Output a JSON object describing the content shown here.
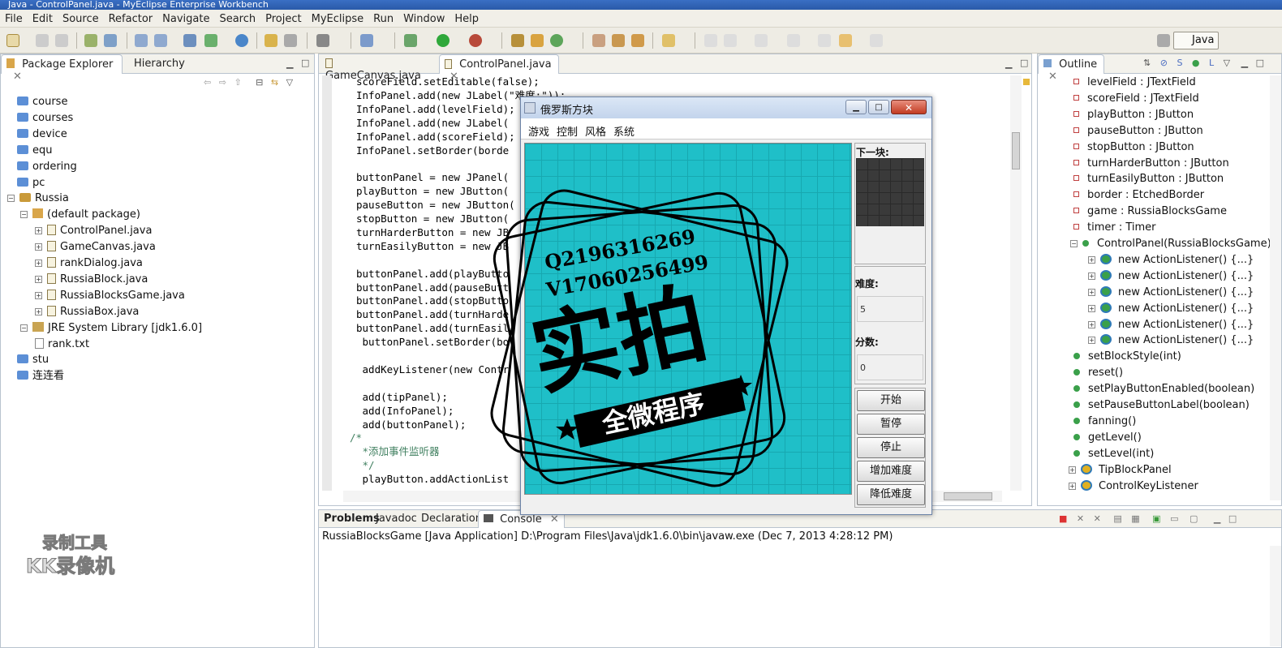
{
  "window": {
    "title": "Java - ControlPanel.java - MyEclipse Enterprise Workbench"
  },
  "menu": [
    "File",
    "Edit",
    "Source",
    "Refactor",
    "Navigate",
    "Search",
    "Project",
    "MyEclipse",
    "Run",
    "Window",
    "Help"
  ],
  "perspective": {
    "label": "Java"
  },
  "package_explorer": {
    "tab_label": "Package Explorer",
    "hierarchy_label": "Hierarchy",
    "items": [
      {
        "label": "course",
        "icon": "folder-icon"
      },
      {
        "label": "courses",
        "icon": "folder-icon"
      },
      {
        "label": "device",
        "icon": "folder-icon"
      },
      {
        "label": "equ",
        "icon": "folder-icon"
      },
      {
        "label": "ordering",
        "icon": "folder-icon"
      },
      {
        "label": "pc",
        "icon": "folder-icon"
      },
      {
        "label": "Russia",
        "icon": "project-icon"
      },
      {
        "label": "(default package)",
        "icon": "package-icon"
      },
      {
        "label": "ControlPanel.java",
        "icon": "java-file-icon"
      },
      {
        "label": "GameCanvas.java",
        "icon": "java-file-icon"
      },
      {
        "label": "rankDialog.java",
        "icon": "java-file-icon"
      },
      {
        "label": "RussiaBlock.java",
        "icon": "java-file-icon"
      },
      {
        "label": "RussiaBlocksGame.java",
        "icon": "java-file-icon"
      },
      {
        "label": "RussiaBox.java",
        "icon": "java-file-icon"
      },
      {
        "label": "JRE System Library [jdk1.6.0]",
        "icon": "library-icon"
      },
      {
        "label": "rank.txt",
        "icon": "text-file-icon"
      },
      {
        "label": "stu",
        "icon": "folder-icon"
      },
      {
        "label": "连连看",
        "icon": "folder-icon"
      }
    ]
  },
  "editor": {
    "tabs": [
      {
        "label": "GameCanvas.java"
      },
      {
        "label": "ControlPanel.java"
      }
    ],
    "lines": [
      "scoreField.setEditable(false);",
      "InfoPanel.add(new JLabel(\"难度:\"));",
      "InfoPanel.add(levelField);",
      "InfoPanel.add(new JLabel(",
      "InfoPanel.add(scoreField);",
      "InfoPanel.setBorder(borde",
      "",
      "buttonPanel = new JPanel(",
      "playButton = new JButton(",
      "pauseButton = new JButton(",
      "stopButton = new JButton(",
      "turnHarderButton = new JB",
      "turnEasilyButton = new JB",
      "",
      "buttonPanel.add(playButto",
      "buttonPanel.add(pauseButt",
      "buttonPanel.add(stopButto",
      "buttonPanel.add(turnHarde",
      "buttonPanel.add(turnEasil",
      " buttonPanel.setBorder(bo",
      "",
      " addKeyListener(new Contr",
      "",
      " add(tipPanel);",
      " add(InfoPanel);",
      " add(buttonPanel);",
      "/*",
      " *添加事件监听器",
      " */",
      " playButton.addActionList"
    ]
  },
  "game_window": {
    "title": "俄罗斯方块",
    "menu": [
      "游戏",
      "控制",
      "风格",
      "系统"
    ],
    "next_label": "下一块:",
    "level_label": "难度:",
    "level_value": "5",
    "score_label": "分数:",
    "score_value": "0",
    "buttons": [
      "开始",
      "暂停",
      "停止",
      "增加难度",
      "降低难度"
    ]
  },
  "watermark": {
    "qq": "Q2196316269",
    "wechat": "V17060256499",
    "big_text": "实拍",
    "banner": "全微程序"
  },
  "recorder_badge": {
    "line1": "录制工具",
    "line2": "KK录像机"
  },
  "outline": {
    "tab_label": "Outline",
    "items": [
      {
        "label": "levelField : JTextField",
        "kind": "field"
      },
      {
        "label": "scoreField : JTextField",
        "kind": "field"
      },
      {
        "label": "playButton : JButton",
        "kind": "field"
      },
      {
        "label": "pauseButton : JButton",
        "kind": "field"
      },
      {
        "label": "stopButton : JButton",
        "kind": "field"
      },
      {
        "label": "turnHarderButton : JButton",
        "kind": "field"
      },
      {
        "label": "turnEasilyButton : JButton",
        "kind": "field"
      },
      {
        "label": "border : EtchedBorder",
        "kind": "field"
      },
      {
        "label": "game : RussiaBlocksGame",
        "kind": "field"
      },
      {
        "label": "timer : Timer",
        "kind": "field"
      },
      {
        "label": "ControlPanel(RussiaBlocksGame)",
        "kind": "method"
      },
      {
        "label": "new ActionListener() {...}",
        "kind": "anon"
      },
      {
        "label": "new ActionListener() {...}",
        "kind": "anon"
      },
      {
        "label": "new ActionListener() {...}",
        "kind": "anon"
      },
      {
        "label": "new ActionListener() {...}",
        "kind": "anon"
      },
      {
        "label": "new ActionListener() {...}",
        "kind": "anon"
      },
      {
        "label": "new ActionListener() {...}",
        "kind": "anon"
      },
      {
        "label": "setBlockStyle(int)",
        "kind": "method"
      },
      {
        "label": "reset()",
        "kind": "method"
      },
      {
        "label": "setPlayButtonEnabled(boolean)",
        "kind": "method"
      },
      {
        "label": "setPauseButtonLabel(boolean)",
        "kind": "method"
      },
      {
        "label": "fanning()",
        "kind": "method"
      },
      {
        "label": "getLevel()",
        "kind": "method"
      },
      {
        "label": "setLevel(int)",
        "kind": "method"
      },
      {
        "label": "TipBlockPanel",
        "kind": "class"
      },
      {
        "label": "ControlKeyListener",
        "kind": "class"
      }
    ]
  },
  "bottom_panel": {
    "tabs": [
      {
        "label": "Problems"
      },
      {
        "label": "Javadoc"
      },
      {
        "label": "Declaration"
      },
      {
        "label": "Console"
      }
    ],
    "console_text": "RussiaBlocksGame [Java Application] D:\\Program Files\\Java\\jdk1.6.0\\bin\\javaw.exe (Dec 7, 2013 4:28:12 PM)"
  }
}
